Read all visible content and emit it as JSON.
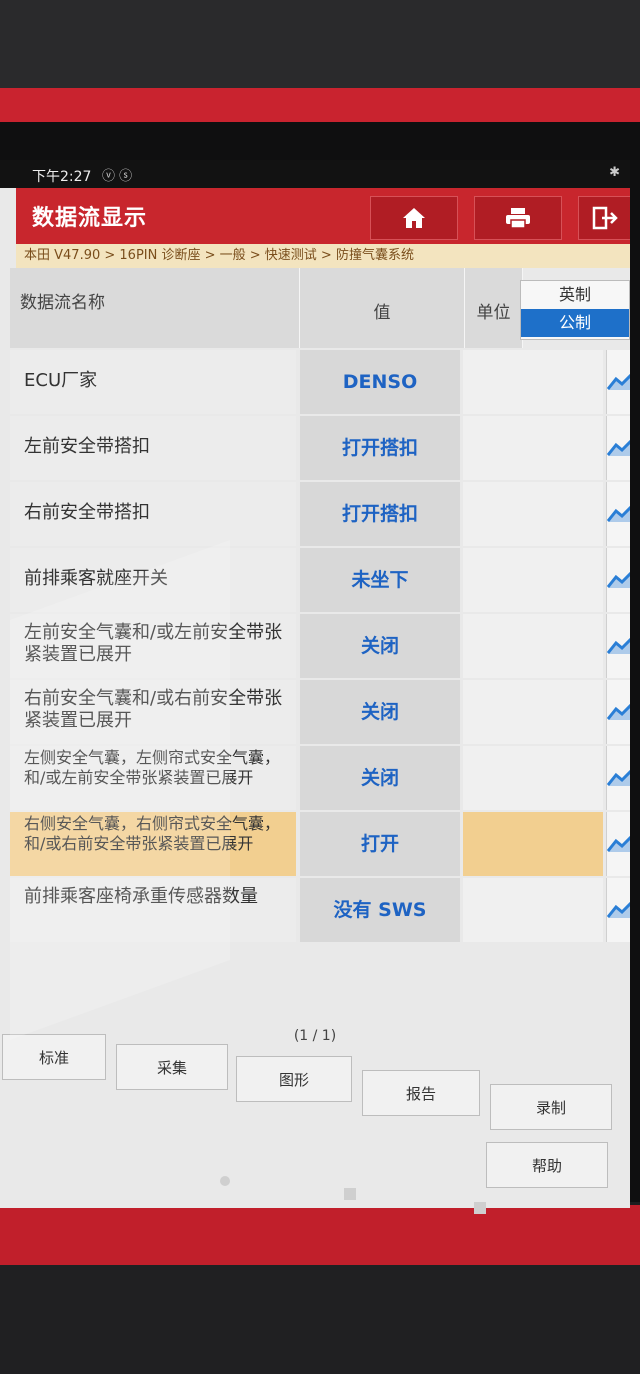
{
  "status_bar": {
    "time": "下午2:27",
    "icons": "ⓥ ⓢ",
    "right_icons": "✱"
  },
  "header": {
    "title": "数据流显示"
  },
  "toolbar": {
    "home_icon": "home-icon",
    "print_icon": "printer-icon",
    "exit_icon": "exit-icon"
  },
  "breadcrumb": "本田 V47.90 > 16PIN 诊断座 > 一般 > 快速测试 > 防撞气囊系统",
  "table": {
    "headers": {
      "name": "数据流名称",
      "value": "值",
      "unit": "单位"
    },
    "unit_toggle": {
      "options": [
        "英制",
        "公制"
      ],
      "selected": "公制"
    },
    "rows": [
      {
        "name": "ECU厂家",
        "value": "DENSO",
        "unit": "",
        "highlighted": false
      },
      {
        "name": "左前安全带搭扣",
        "value": "打开搭扣",
        "unit": "",
        "highlighted": false
      },
      {
        "name": "右前安全带搭扣",
        "value": "打开搭扣",
        "unit": "",
        "highlighted": false
      },
      {
        "name": "前排乘客就座开关",
        "value": "未坐下",
        "unit": "",
        "highlighted": false
      },
      {
        "name": "左前安全气囊和/或左前安全带张紧装置已展开",
        "value": "关闭",
        "unit": "",
        "highlighted": false
      },
      {
        "name": "右前安全气囊和/或右前安全带张紧装置已展开",
        "value": "关闭",
        "unit": "",
        "highlighted": false
      },
      {
        "name": "左侧安全气囊，左侧帘式安全气囊，和/或左前安全带张紧装置已展开",
        "value": "关闭",
        "unit": "",
        "highlighted": false
      },
      {
        "name": "右侧安全气囊，右侧帘式安全气囊，和/或右前安全带张紧装置已展开",
        "value": "打开",
        "unit": "",
        "highlighted": true
      },
      {
        "name": "前排乘客座椅承重传感器数量",
        "value": "没有 SWS",
        "unit": "",
        "highlighted": false
      }
    ]
  },
  "pagination": "(1 / 1)",
  "bottom_buttons": {
    "standard": "标准",
    "collect": "采集",
    "graph": "图形",
    "report": "报告",
    "record": "录制",
    "help": "帮助"
  },
  "colors": {
    "brand_red": "#c8262d",
    "value_blue": "#1e63c3",
    "toggle_blue": "#1e70c9",
    "highlight": "#f2cf90"
  }
}
